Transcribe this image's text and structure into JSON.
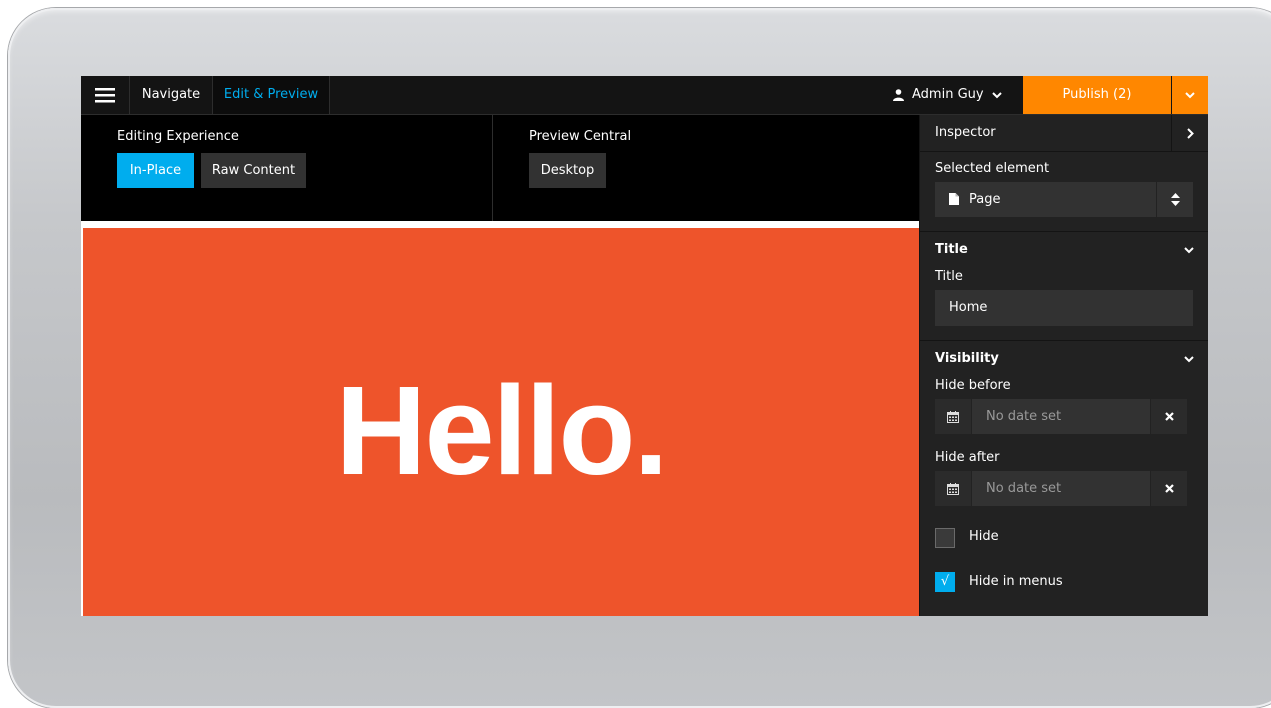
{
  "topbar": {
    "tabs": [
      {
        "label": "Navigate"
      },
      {
        "label": "Edit & Preview"
      }
    ],
    "user": {
      "name": "Admin Guy"
    },
    "publish": {
      "label": "Publish (2)"
    }
  },
  "editing": {
    "label": "Editing Experience",
    "buttons": [
      {
        "label": "In-Place"
      },
      {
        "label": "Raw Content"
      }
    ]
  },
  "preview_central": {
    "label": "Preview Central",
    "mode": "Desktop"
  },
  "canvas": {
    "headline": "Hello."
  },
  "inspector": {
    "title": "Inspector",
    "selected_label": "Selected element",
    "selected_value": "Page",
    "title_section": {
      "heading": "Title",
      "field_label": "Title",
      "value": "Home"
    },
    "visibility": {
      "heading": "Visibility",
      "hide_before": {
        "label": "Hide before",
        "value": "No date set"
      },
      "hide_after": {
        "label": "Hide after",
        "value": "No date set"
      },
      "hide": {
        "label": "Hide",
        "checked": false
      },
      "hide_in_menus": {
        "label": "Hide in menus",
        "checked": true,
        "mark": "√"
      }
    }
  },
  "colors": {
    "accent_blue": "#00adee",
    "publish_orange": "#ff8700",
    "hero_orange": "#ee542b",
    "panel": "#222222"
  }
}
